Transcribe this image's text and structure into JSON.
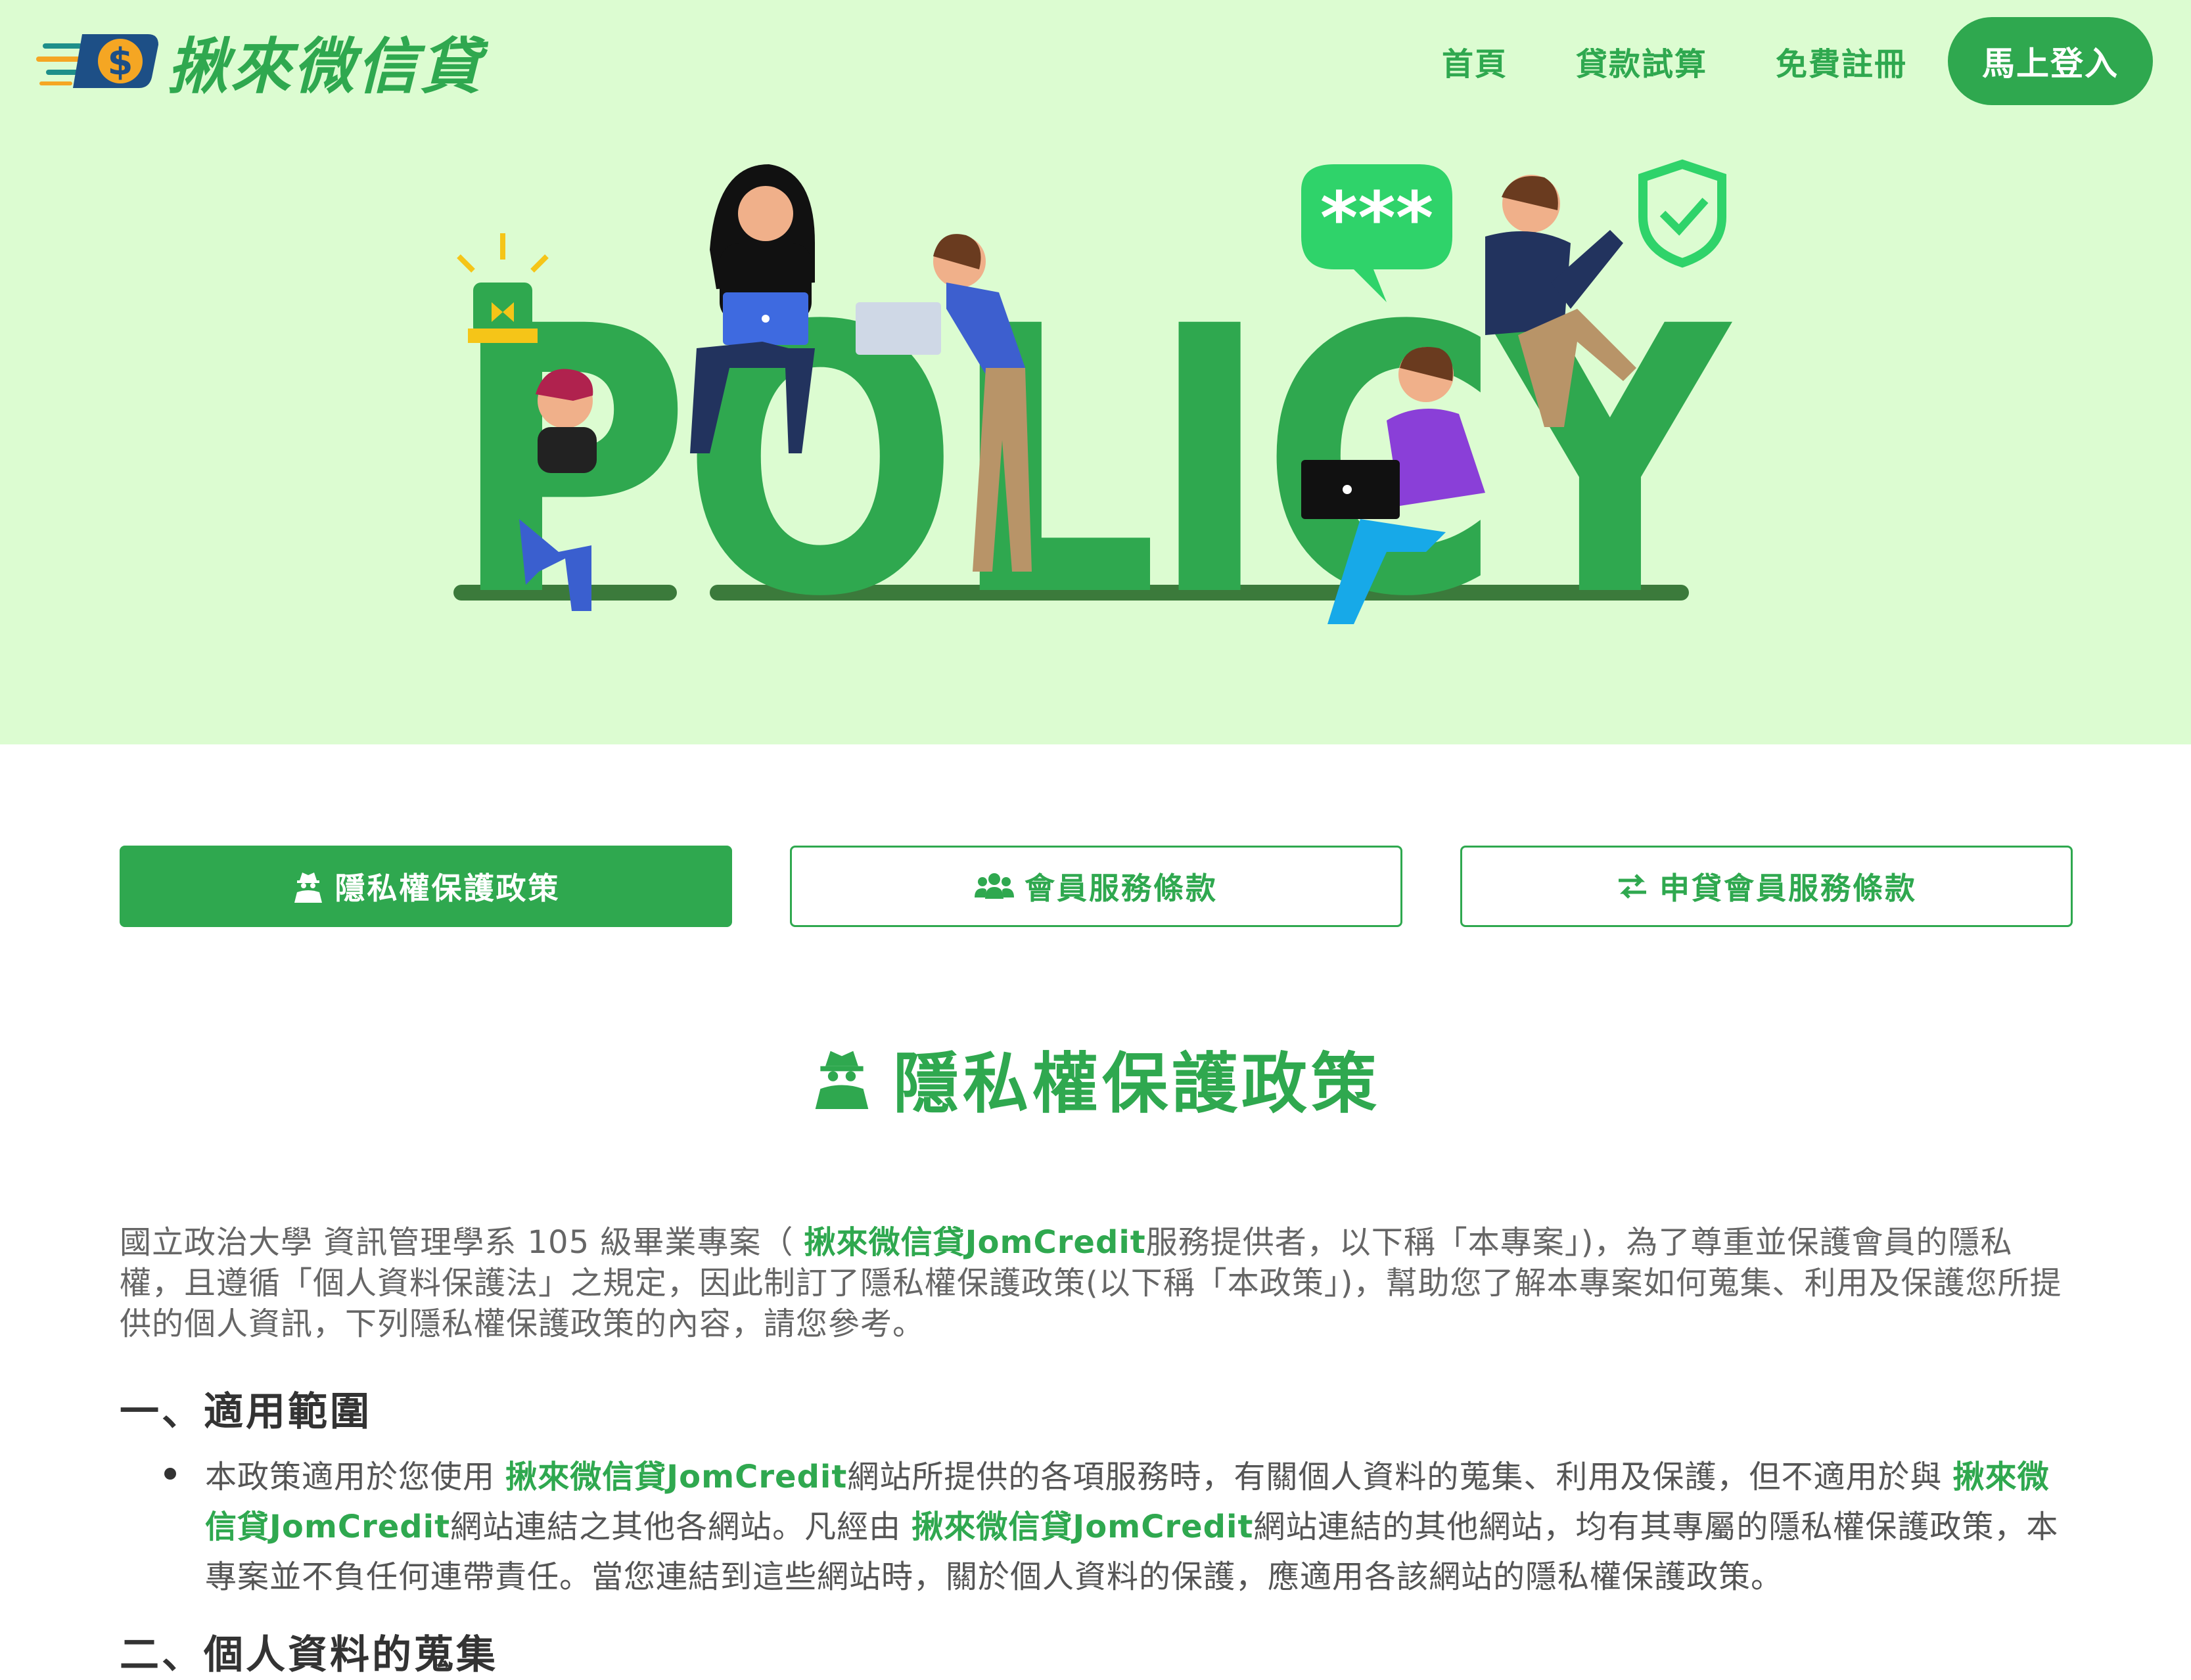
{
  "header": {
    "logo_text": "揪來微信貸",
    "nav": [
      {
        "label": "首頁"
      },
      {
        "label": "貸款試算"
      },
      {
        "label": "免費註冊"
      }
    ],
    "login_label": "馬上登入"
  },
  "hero": {
    "policy_word": "POLICY",
    "bubble_text": "***"
  },
  "tabs": [
    {
      "label": "隱私權保護政策",
      "icon": "user-secret-icon",
      "active": true
    },
    {
      "label": "會員服務條款",
      "icon": "users-icon",
      "active": false
    },
    {
      "label": "申貸會員服務條款",
      "icon": "exchange-icon",
      "active": false
    }
  ],
  "section": {
    "title": "隱私權保護政策",
    "intro_part1": "國立政治大學 資訊管理學系 105 級畢業專案（ ",
    "brand": "揪來微信貸JomCredit",
    "intro_part2": "服務提供者，以下稱「本專案」)，為了尊重並保護會員的隱私權，且遵循「個人資料保護法」之規定，因此制訂了隱私權保護政策(以下稱「本政策」)，幫助您了解本專案如何蒐集、利用及保護您所提供的個人資訊，下列隱私權保護政策的內容，請您參考。",
    "heading1": "一、適用範圍",
    "bullet1_part1": "本政策適用於您使用 ",
    "bullet1_part2": "網站所提供的各項服務時，有關個人資料的蒐集、利用及保護，但不適用於與 ",
    "bullet1_part3": "網站連結之其他各網站。凡經由 ",
    "bullet1_part4": "網站連結的其他網站，均有其專屬的隱私權保護政策，本專案並不負任何連帶責任。當您連結到這些網站時，關於個人資料的保護，應適用各該網站的隱私權保護政策。",
    "heading2": "二、個人資料的蒐集"
  },
  "colors": {
    "primary": "#2fa84f",
    "hero_bg": "#dcfcd1",
    "text": "#666666"
  }
}
